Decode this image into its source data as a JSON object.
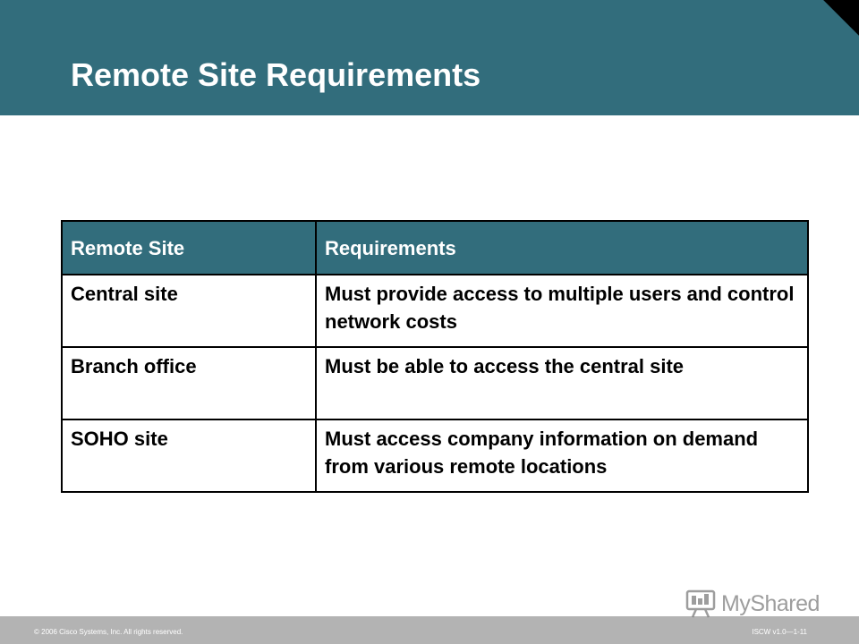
{
  "slide": {
    "title": "Remote Site Requirements",
    "colors": {
      "header_band": "#326d7c",
      "table_header": "#326d7c",
      "footer_band": "#b3b3b3"
    }
  },
  "table": {
    "headers": [
      "Remote Site",
      "Requirements"
    ],
    "rows": [
      {
        "site": "Central site",
        "requirement": "Must provide access to multiple users and control network costs"
      },
      {
        "site": "Branch office",
        "requirement": "Must be able to access the central site"
      },
      {
        "site": "SOHO site",
        "requirement": "Must access company information on demand from various remote locations"
      }
    ]
  },
  "footer": {
    "copyright": "© 2006 Cisco Systems, Inc. All rights reserved.",
    "course_id": "ISCW v1.0—1-11"
  },
  "watermark": {
    "text": "MyShared",
    "icon": "presentation-board-icon"
  }
}
